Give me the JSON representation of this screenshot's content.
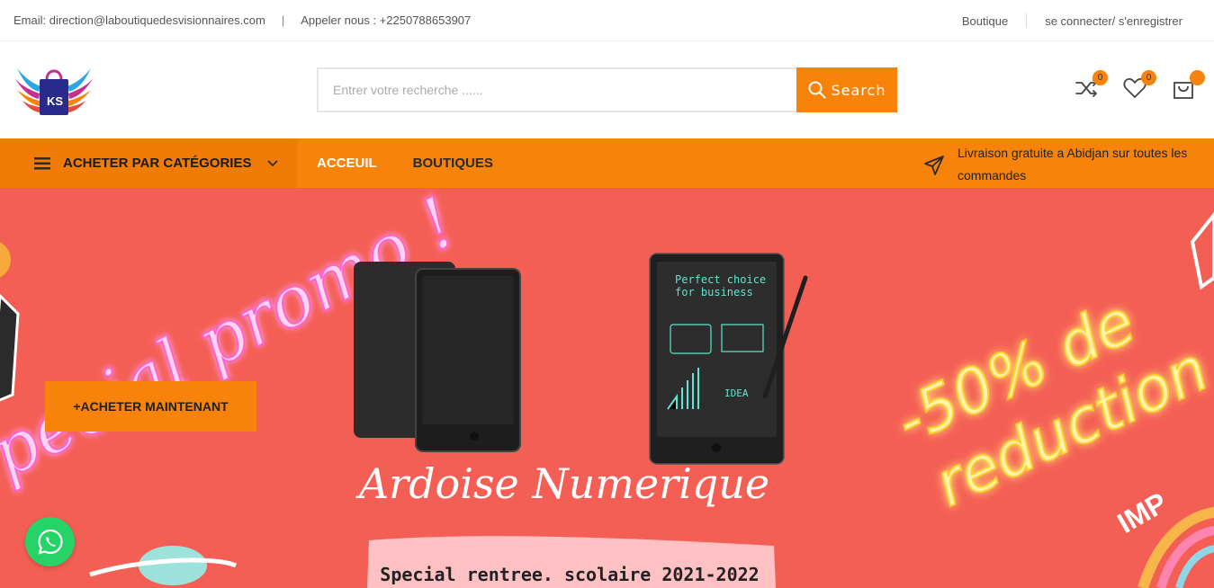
{
  "topbar": {
    "email": "Email: direction@laboutiquedesvisionnaires.com",
    "separator": "|",
    "phone": "Appeler nous : +2250788653907",
    "shop_link": "Boutique",
    "login_link": "se connecter/ s'enregistrer"
  },
  "header": {
    "logo_text": "KS",
    "search_placeholder": "Entrer votre recherche ......",
    "search_button": "Search",
    "compare_count": "0",
    "wishlist_count": "0",
    "cart_count": ""
  },
  "nav": {
    "categories_label": "ACHETER PAR CATÉGORIES",
    "items": [
      {
        "label": "ACCEUIL"
      },
      {
        "label": "BOUTIQUES"
      }
    ],
    "shipping_text": "Livraison gratuite a Abidjan sur toutes les commandes"
  },
  "banner": {
    "neon_promo": "Special promo !",
    "tablet_line1": "Perfect choice",
    "tablet_line2": "for business",
    "tablet_idea": "IDEA",
    "product_title": "Ardoise Numerique",
    "discount_line1": "-50% de",
    "discount_line2": "reduction",
    "subtitle": "Special rentree. scolaire 2021-2022",
    "cta": "+ACHETER MAINTENANT",
    "corner_text": "IMP"
  },
  "colors": {
    "accent": "#f7830b",
    "banner_bg": "#f45f55",
    "neon_pink": "#ff7ad9",
    "neon_yellow": "#ffe24a",
    "whatsapp": "#25d366"
  }
}
